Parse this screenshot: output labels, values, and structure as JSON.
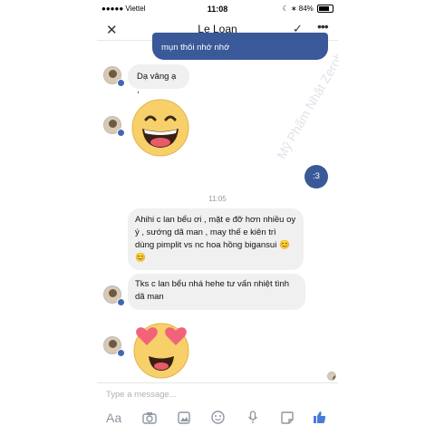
{
  "status_bar": {
    "carrier": "●●●●● Viettel",
    "time": "11:08",
    "battery": "84%",
    "battery_level": 0.84
  },
  "header": {
    "title": "Le Loan"
  },
  "messages": {
    "out_partial": "mụn thôi nhớ nhớ",
    "in_1": "Dạ vâng ạ ,",
    "emoji_1": "laughing",
    "out_2": ":3",
    "timestamp": "11:05",
    "in_2": "Ahihi c lan bểu ơi , mặt e đỡ hơn nhiều oy ý , sướng dã man , may thế e kiên trì dùng pimplit vs nc hoa hồng bigansui 😊😊",
    "in_3": "Tks c lan bểu nhá hehe tư vấn nhiệt tình dã man",
    "emoji_2": "heart-eyes"
  },
  "watermark": "Mỹ Phẩm Nhật Zerohop",
  "composer": {
    "placeholder": "Type a message..."
  },
  "toolbar": {
    "text_label": "Aa",
    "icons": [
      "camera-icon",
      "image-icon",
      "emoji-icon",
      "microphone-icon",
      "sticker-icon",
      "like-icon"
    ]
  }
}
